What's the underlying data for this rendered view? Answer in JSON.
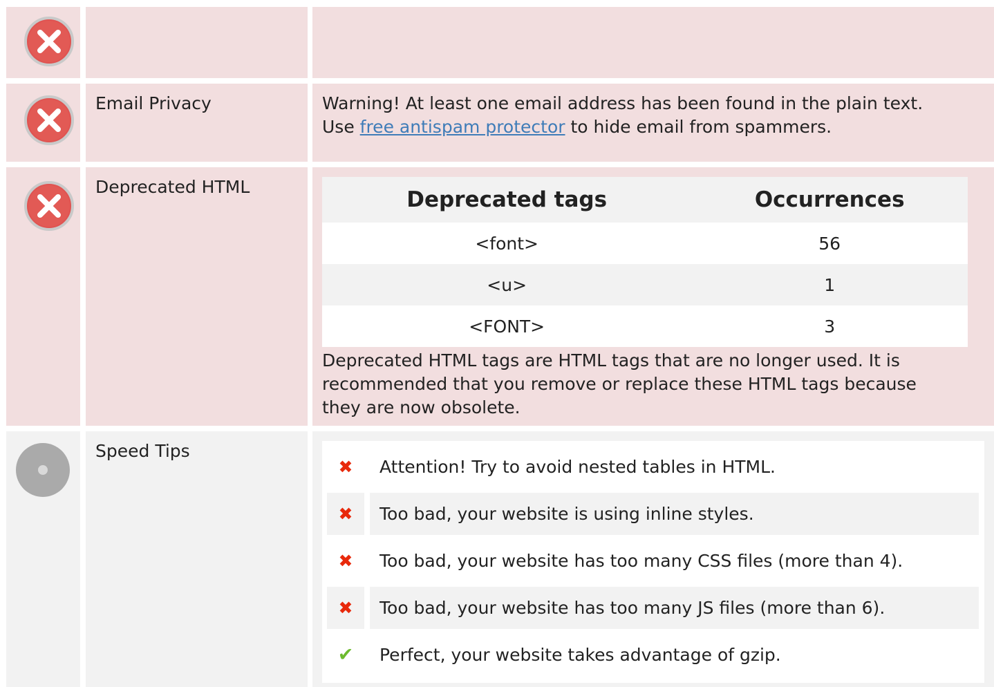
{
  "rows": {
    "empty": {
      "status": "error"
    },
    "email": {
      "label": "Email Privacy",
      "line1": "Warning! At least one email address has been found in the plain text.",
      "line2_pre": "Use ",
      "link": "free antispam protector",
      "line2_post": " to hide email from spammers."
    },
    "deprecated": {
      "label": "Deprecated HTML",
      "headers": [
        "Deprecated tags",
        "Occurrences"
      ],
      "rows": [
        {
          "tag": "<font>",
          "count": "56"
        },
        {
          "tag": "<u>",
          "count": "1"
        },
        {
          "tag": "<FONT>",
          "count": "3"
        }
      ],
      "note_lines": [
        "Deprecated HTML tags are HTML tags that are no longer used. It is",
        "recommended that you remove or replace these HTML tags because",
        "they are now obsolete."
      ]
    },
    "speed": {
      "label": "Speed Tips",
      "tips": [
        {
          "text": "Attention! Try to avoid nested tables in HTML.",
          "status": "fail"
        },
        {
          "text": "Too bad, your website is using inline styles.",
          "status": "fail"
        },
        {
          "text": "Too bad, your website has too many CSS files (more than 4).",
          "status": "fail"
        },
        {
          "text": "Too bad, your website has too many JS files (more than 6).",
          "status": "fail"
        },
        {
          "text": "Perfect, your website takes advantage of gzip.",
          "status": "pass"
        }
      ]
    }
  },
  "icons": {
    "error": "error-circle-icon",
    "neutral": "neutral-circle-icon",
    "fail": "red-x-icon",
    "pass": "green-check-icon"
  },
  "colors": {
    "error_row": "#f2dedf",
    "neutral_row": "#f2f2f2",
    "error_icon": "#e05351",
    "neutral_icon": "#aaaaaa",
    "link": "#3f7cb8",
    "fail_mark": "#e8290b",
    "pass_mark": "#6dbb2e"
  }
}
